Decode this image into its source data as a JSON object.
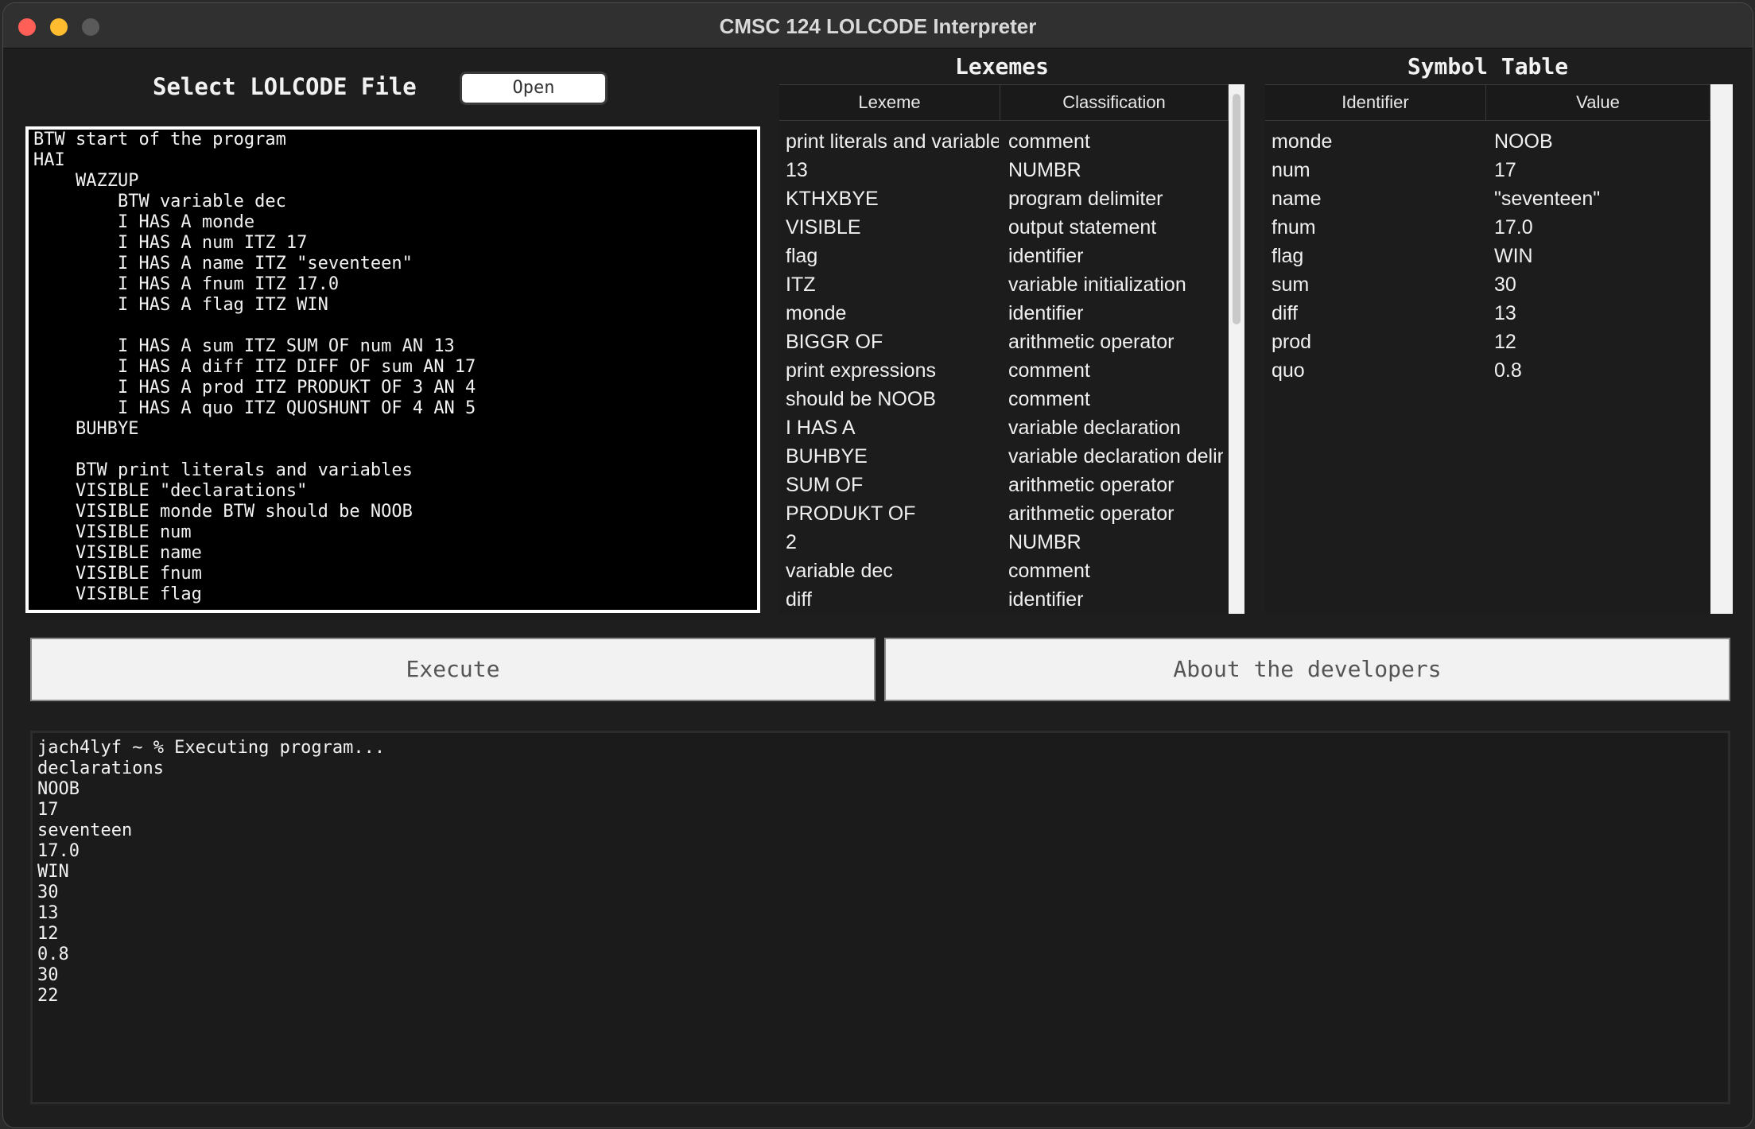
{
  "window": {
    "title": "CMSC 124 LOLCODE Interpreter"
  },
  "file_picker": {
    "label": "Select LOLCODE File",
    "open_label": "Open"
  },
  "editor": {
    "lines": [
      "BTW start of the program",
      "HAI",
      "    WAZZUP",
      "        BTW variable dec",
      "        I HAS A monde",
      "        I HAS A num ITZ 17",
      "        I HAS A name ITZ \"seventeen\"",
      "        I HAS A fnum ITZ 17.0",
      "        I HAS A flag ITZ WIN",
      "",
      "        I HAS A sum ITZ SUM OF num AN 13",
      "        I HAS A diff ITZ DIFF OF sum AN 17",
      "        I HAS A prod ITZ PRODUKT OF 3 AN 4",
      "        I HAS A quo ITZ QUOSHUNT OF 4 AN 5",
      "    BUHBYE",
      "",
      "    BTW print literals and variables",
      "    VISIBLE \"declarations\"",
      "    VISIBLE monde BTW should be NOOB",
      "    VISIBLE num",
      "    VISIBLE name",
      "    VISIBLE fnum",
      "    VISIBLE flag"
    ]
  },
  "lexemes": {
    "title": "Lexemes",
    "columns": [
      "Lexeme",
      "Classification"
    ],
    "rows": [
      [
        "print literals and variables",
        "comment"
      ],
      [
        "13",
        "NUMBR"
      ],
      [
        "KTHXBYE",
        "program delimiter"
      ],
      [
        "VISIBLE",
        "output statement"
      ],
      [
        "flag",
        "identifier"
      ],
      [
        "ITZ",
        "variable initialization"
      ],
      [
        "monde",
        "identifier"
      ],
      [
        "BIGGR OF",
        "arithmetic operator"
      ],
      [
        "print expressions",
        "comment"
      ],
      [
        "should be NOOB",
        "comment"
      ],
      [
        "I HAS A",
        "variable declaration"
      ],
      [
        "BUHBYE",
        "variable declaration delimiter"
      ],
      [
        "SUM OF",
        "arithmetic operator"
      ],
      [
        "PRODUKT OF",
        "arithmetic operator"
      ],
      [
        "2",
        "NUMBR"
      ],
      [
        "variable dec",
        "comment"
      ],
      [
        "diff",
        "identifier"
      ]
    ]
  },
  "symbol_table": {
    "title": "Symbol Table",
    "columns": [
      "Identifier",
      "Value"
    ],
    "rows": [
      [
        "monde",
        "NOOB"
      ],
      [
        "num",
        "17"
      ],
      [
        "name",
        "\"seventeen\""
      ],
      [
        "fnum",
        "17.0"
      ],
      [
        "flag",
        "WIN"
      ],
      [
        "sum",
        "30"
      ],
      [
        "diff",
        "13"
      ],
      [
        "prod",
        "12"
      ],
      [
        "quo",
        "0.8"
      ]
    ]
  },
  "buttons": {
    "execute": "Execute",
    "about": "About the developers"
  },
  "console": {
    "lines": [
      "jach4lyf ~ % Executing program...",
      "declarations",
      "NOOB",
      "17",
      "seventeen",
      "17.0",
      "WIN",
      "30",
      "13",
      "12",
      "0.8",
      "30",
      "22"
    ]
  }
}
